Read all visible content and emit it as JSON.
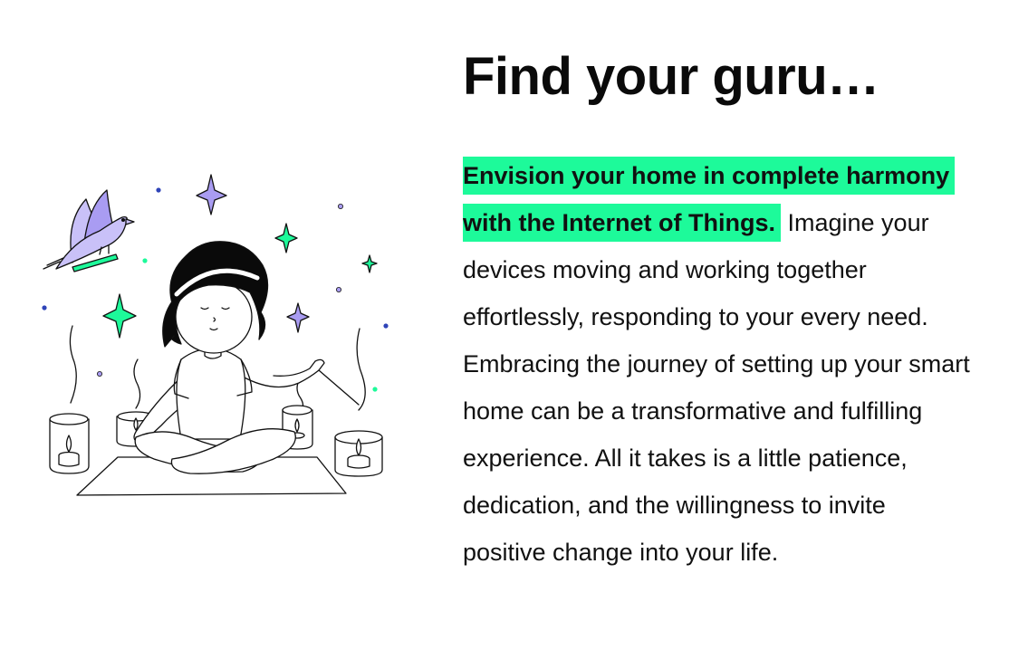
{
  "heading": {
    "title": "Find your guru…"
  },
  "paragraph": {
    "highlight": "Envision your home in complete harmony with the Internet of Things.",
    "text": "Imagine your devices moving and working together effortlessly, responding to your every need. Embracing the journey of setting up your smart home can be a transformative and fulfilling experience. All it takes is a little patience, dedication, and the willingness to invite positive change into your life."
  },
  "colors": {
    "highlight": "#1dfa9a",
    "accent_purple": "#a99cf2",
    "accent_green": "#1dfa9a",
    "accent_blue": "#2f44b8",
    "text": "#111111"
  },
  "icons": [
    "meditating-person-illustration",
    "bird-icon",
    "sparkle-icon",
    "candle-icon"
  ]
}
